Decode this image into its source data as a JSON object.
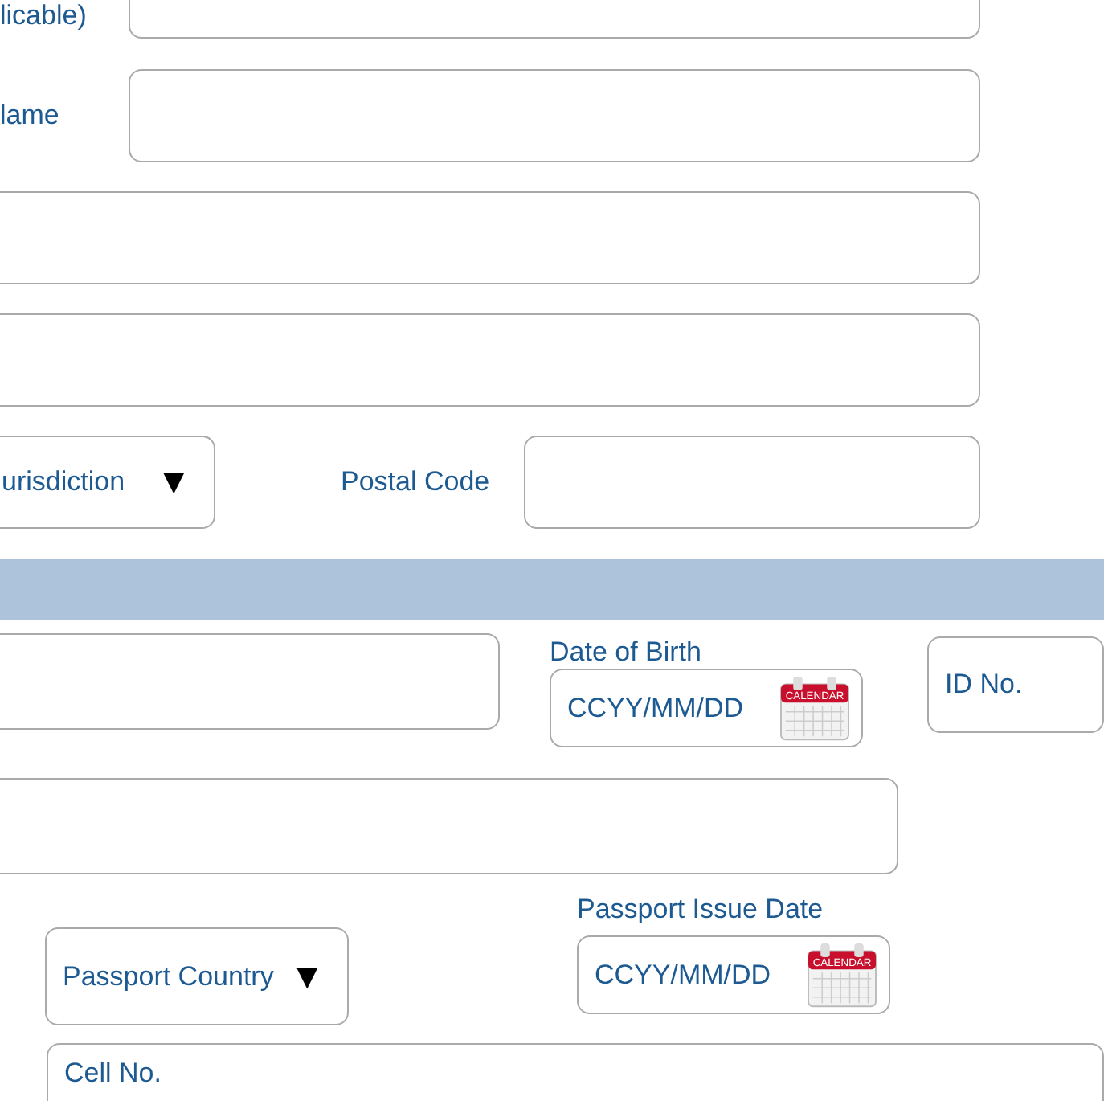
{
  "section1": {
    "field_label_1": "licable)",
    "field_label_2": "lame",
    "jurisdiction_select": {
      "value": "urisdiction",
      "caret": "▼"
    },
    "postal_code_label": "Postal Code"
  },
  "section2": {
    "date_of_birth": {
      "label": "Date of Birth",
      "placeholder": "CCYY/MM/DD",
      "icon_text": "CALENDAR"
    },
    "id_no": {
      "placeholder": "ID No."
    },
    "passport_issue_date": {
      "label": "Passport Issue Date",
      "placeholder": "CCYY/MM/DD",
      "icon_text": "CALENDAR"
    },
    "passport_country_select": {
      "value": "Passport Country",
      "caret": "▼"
    },
    "cell_no": {
      "placeholder": "Cell No."
    }
  }
}
